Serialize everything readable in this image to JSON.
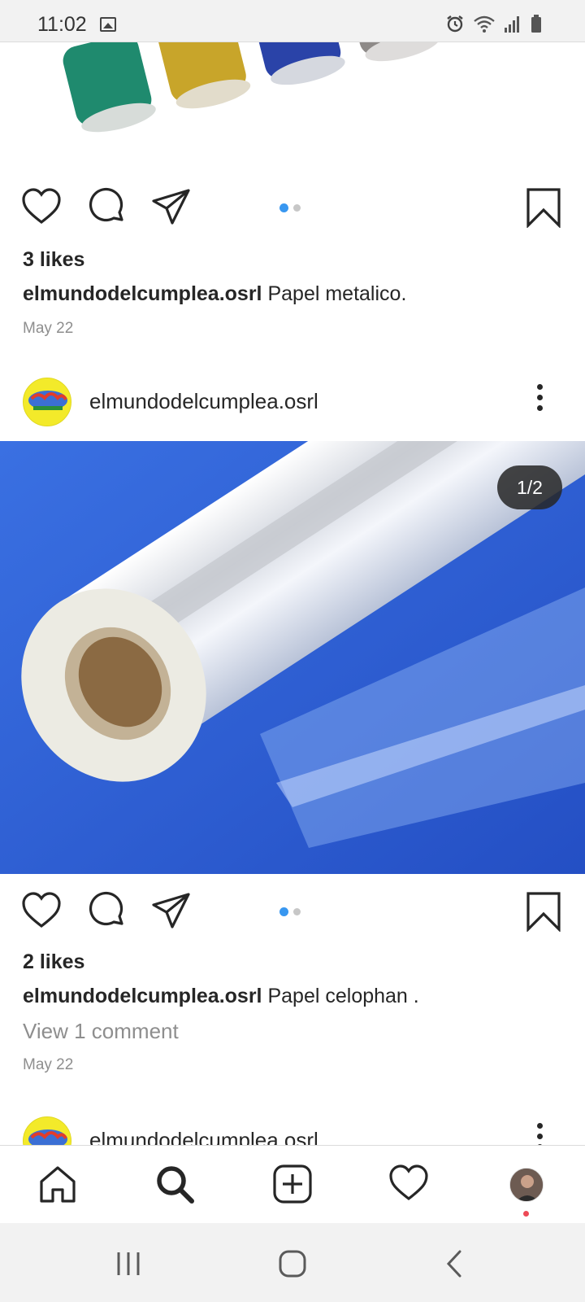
{
  "status_bar": {
    "time": "11:02",
    "icons": [
      "gallery-icon",
      "alarm-icon",
      "wifi-icon",
      "signal-icon",
      "battery-icon"
    ]
  },
  "post_previous": {
    "likes": "3 likes",
    "username": "elmundodelcumplea.osrl",
    "caption_text": "Papel metalico.",
    "date": "May 22",
    "carousel_index": 0,
    "carousel_count": 2,
    "roll_colors": [
      "#1f8a6e",
      "#c8a52a",
      "#2a43a8",
      "#8e8a88",
      "#c1302b"
    ]
  },
  "post_current": {
    "username": "elmundodelcumplea.osrl",
    "image_counter": "1/2",
    "likes": "2 likes",
    "caption_user": "elmundodelcumplea.osrl",
    "caption_text": "Papel celophan .",
    "view_comments": "View 1 comment",
    "date": "May 22",
    "carousel_index": 0,
    "carousel_count": 2
  },
  "post_next": {
    "username": "elmundodelcumplea.osrl"
  },
  "bottom_nav": {
    "items": [
      "home-icon",
      "search-icon",
      "new-post-icon",
      "activity-icon",
      "profile-avatar"
    ],
    "active": "search-icon"
  },
  "colors": {
    "accent": "#3897f0",
    "text": "#262626",
    "secondary_text": "#8e8e8e",
    "notification": "#ed4956",
    "avatar_yellow": "#f3ea2a",
    "image_blue": "#2f62d6"
  }
}
